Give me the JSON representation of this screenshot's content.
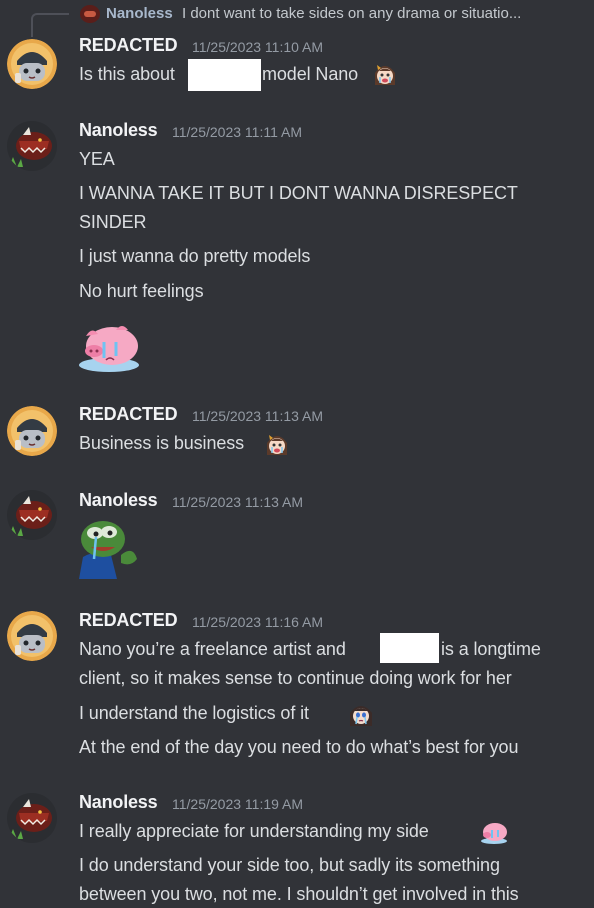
{
  "reply": {
    "author": "Nanoless",
    "text": "I dont want to take sides on any drama or situatio..."
  },
  "messages": [
    {
      "author": "REDACTED",
      "timestamp": "11/25/2023 11:10 AM",
      "lines": [
        "Is this about",
        "model Nano"
      ]
    },
    {
      "author": "Nanoless",
      "timestamp": "11/25/2023 11:11 AM",
      "lines": [
        "YEA",
        "I WANNA TAKE IT BUT I DONT WANNA DISRESPECT",
        "SINDER",
        "I just wanna do pretty models",
        "No hurt feelings"
      ]
    },
    {
      "author": "REDACTED",
      "timestamp": "11/25/2023 11:13 AM",
      "lines": [
        "Business is business"
      ]
    },
    {
      "author": "Nanoless",
      "timestamp": "11/25/2023 11:13 AM",
      "lines": []
    },
    {
      "author": "REDACTED",
      "timestamp": "11/25/2023 11:16 AM",
      "lines": [
        "Nano you’re a freelance artist and",
        "is a longtime",
        "client, so it makes sense to continue doing work for her",
        "I understand the logistics of it",
        "At the end of the day you need to do what’s best for you"
      ]
    },
    {
      "author": "Nanoless",
      "timestamp": "11/25/2023 11:19 AM",
      "lines": [
        "I really appreciate for understanding my side",
        "I do understand your side too, but sadly its something",
        "between you two, not me. I shouldn’t get involved in this"
      ]
    }
  ],
  "icons": {
    "redacted_avatar": "grey-cat-helmet-avatar",
    "nanoless_avatar": "red-dragon-avatar",
    "anime_girl_emoji": "crying-anime-girl-emoji",
    "pig_sticker": "crying-pink-pig-sticker",
    "pepe_sticker": "crying-frog-sticker",
    "pig_emoji": "pink-pig-emoji"
  },
  "colors": {
    "background": "#313338",
    "author": "#f2f3f5",
    "timestamp": "#949ba4",
    "text": "#dbdee1"
  }
}
